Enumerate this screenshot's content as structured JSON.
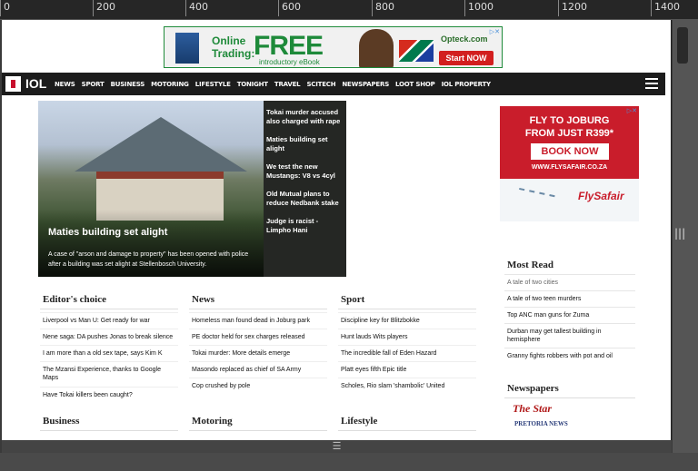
{
  "ruler": {
    "labels": [
      "0",
      "200",
      "400",
      "600",
      "800",
      "1000",
      "1200",
      "1400"
    ]
  },
  "ad_top": {
    "line1": "Online",
    "line2": "Trading:",
    "headline": "FREE",
    "subline": "introductory eBook",
    "brand": "Opteck.com",
    "cta": "Start NOW"
  },
  "logo": "IOL",
  "nav": [
    "NEWS",
    "SPORT",
    "BUSINESS",
    "MOTORING",
    "LIFESTYLE",
    "TONIGHT",
    "TRAVEL",
    "SCITECH",
    "NEWSPAPERS",
    "LOOT SHOP",
    "IOL PROPERTY"
  ],
  "hero": {
    "headline": "Maties building set alight",
    "caption": "A case of \"arson and damage to property\" has been opened with police after a building was set alight at Stellenbosch University.",
    "side_stories": [
      "Tokai murder accused also charged with rape",
      "Maties building set alight",
      "We test the new Mustangs: V8 vs 4cyl",
      "Old Mutual plans to reduce Nedbank stake",
      "Judge is racist - Limpho Hani"
    ]
  },
  "ad_right": {
    "line1": "FLY TO JOBURG",
    "line2": "FROM JUST R399*",
    "cta": "BOOK NOW",
    "url": "WWW.FLYSAFAIR.CO.ZA",
    "brand": "FlySafair"
  },
  "sections": {
    "editors_choice": {
      "title": "Editor's choice",
      "items": [
        "Liverpool vs Man U: Get ready for war",
        "Nene saga: DA pushes Jonas to break silence",
        "I am more than a old sex tape, says Kim K",
        "The Mzansi Experience, thanks to Google Maps",
        "Have Tokai killers been caught?"
      ]
    },
    "news": {
      "title": "News",
      "items": [
        "Homeless man found dead in Joburg park",
        "PE doctor held for sex charges released",
        "Tokai murder: More details emerge",
        "Masondo replaced as chief of SA Army",
        "Cop crushed by pole"
      ]
    },
    "sport": {
      "title": "Sport",
      "items": [
        "Discipline key for Blitzbokke",
        "Hunt lauds Wits players",
        "The incredible fall of Eden Hazard",
        "Platt eyes fifth Epic title",
        "Scholes, Rio slam 'shambolic' United"
      ]
    },
    "business": {
      "title": "Business"
    },
    "motoring": {
      "title": "Motoring"
    },
    "lifestyle": {
      "title": "Lifestyle"
    }
  },
  "most_read": {
    "title": "Most Read",
    "items": [
      "A tale of two cities",
      "A tale of two teen murders",
      "Top ANC man guns for Zuma",
      "Durban may get tallest building in hemisphere",
      "Granny fights robbers with pot and oil"
    ]
  },
  "newspapers": {
    "title": "Newspapers",
    "logos": [
      "The Star",
      "PRETORIA NEWS"
    ]
  },
  "colors": {
    "nav_bg": "#1c1c1c",
    "brand_red": "#c8102e",
    "flysafair_red": "#c91d2b",
    "ad_green": "#1e8a3a"
  }
}
